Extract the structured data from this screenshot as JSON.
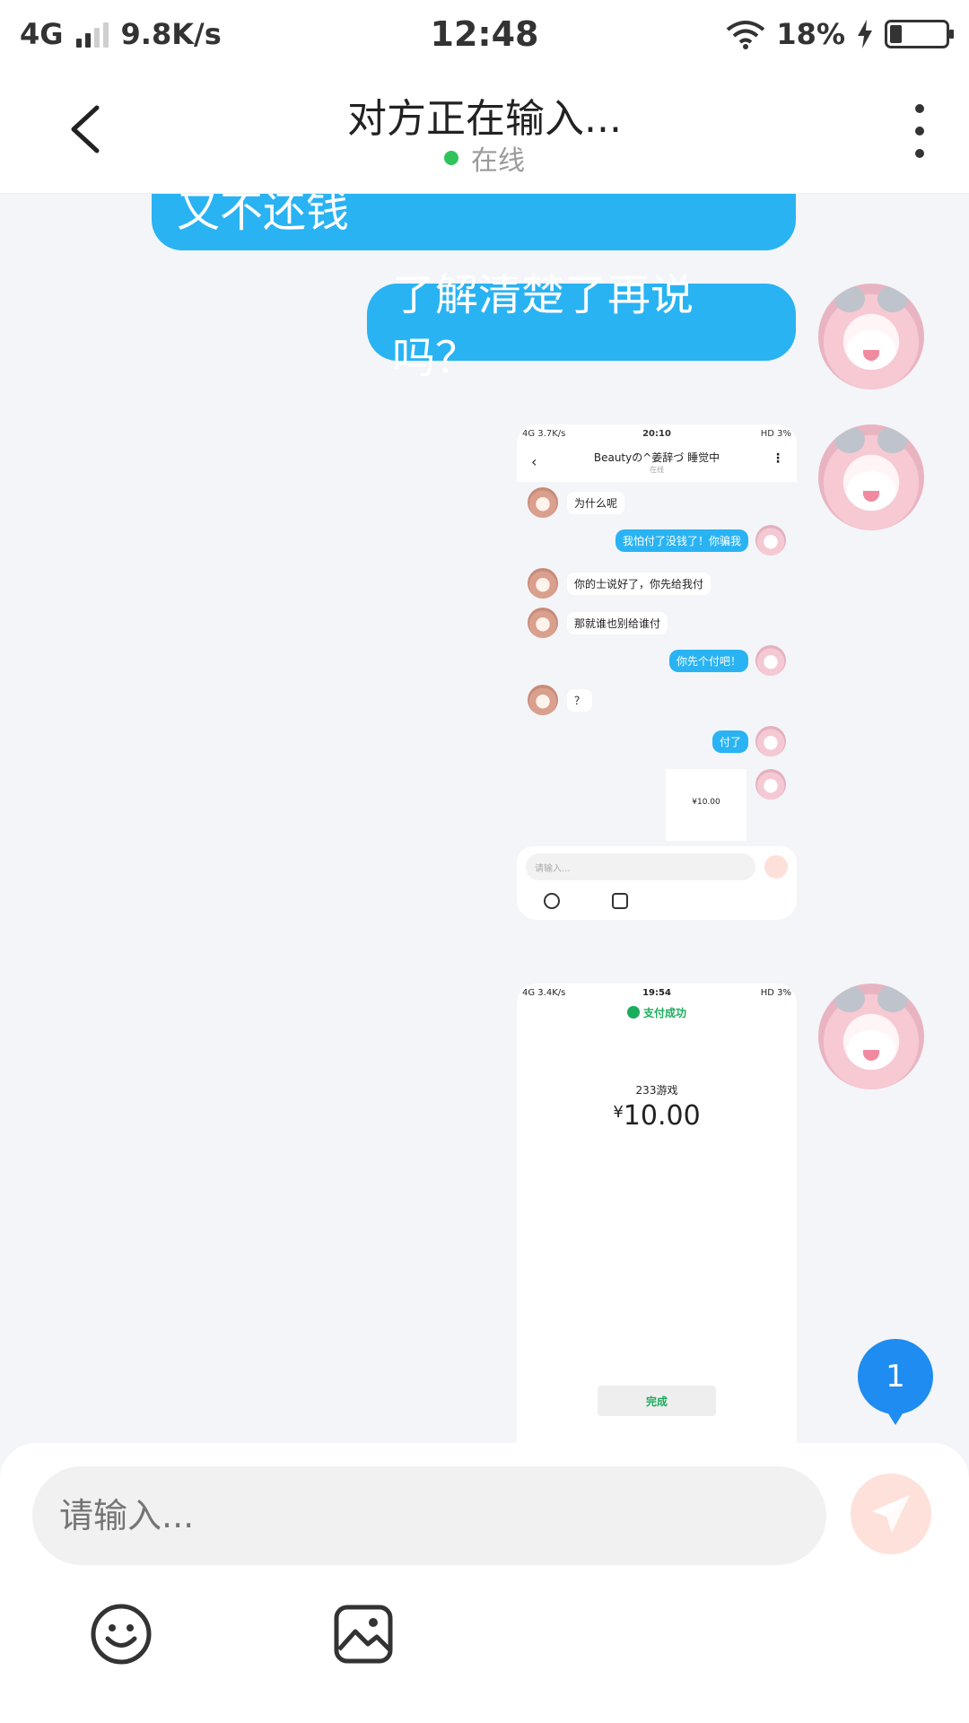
{
  "status_bar": {
    "network": "4G",
    "speed": "9.8K/s",
    "time": "12:48",
    "battery": "18%"
  },
  "header": {
    "title": "对方正在输入...",
    "status": "在线"
  },
  "messages": {
    "msg1": "又不还钱",
    "msg2": "了解清楚了再说吗？"
  },
  "screenshot1": {
    "status_left": "4G 3.7K/s",
    "time": "20:10",
    "status_right": "HD 3%",
    "title": "Beautyの^姜辞づ 睡觉中",
    "subtitle": "在线",
    "rows": [
      {
        "text": "为什么呢"
      },
      {
        "text": "我怕付了没钱了！你骗我"
      },
      {
        "text": "你的士说好了，你先给我付"
      },
      {
        "text": "那就谁也别给谁付"
      },
      {
        "text": "你先个付吧！"
      },
      {
        "text": "？"
      },
      {
        "text": "付了"
      },
      {
        "text": "¥10.00"
      }
    ],
    "input_placeholder": "请输入..."
  },
  "screenshot2": {
    "status_left": "4G 3.4K/s",
    "time": "19:54",
    "status_right": "HD 3%",
    "paid": "支付成功",
    "merchant": "233游戏",
    "yen": "¥",
    "amount": "10.00",
    "done": "完成"
  },
  "unread_count": "1",
  "input": {
    "placeholder": "请输入..."
  },
  "colors": {
    "bubble": "#29b3f3",
    "online": "#2fc45a",
    "unread": "#1e8cf0",
    "send": "#fde1da"
  }
}
